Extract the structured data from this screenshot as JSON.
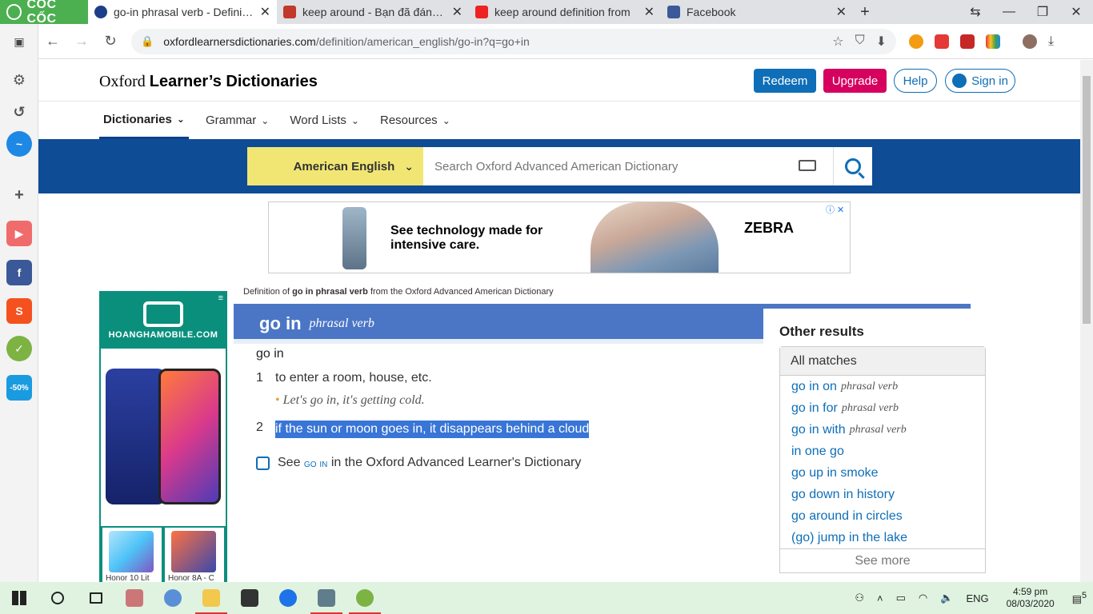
{
  "browser": {
    "brand": "CỐC CỐC",
    "tabs": [
      {
        "title": "go-in phrasal verb - Definitio",
        "active": true
      },
      {
        "title": "keep around - Bạn đã đánh v",
        "active": false
      },
      {
        "title": "keep around definition from",
        "active": false
      },
      {
        "title": "Facebook",
        "active": false
      }
    ],
    "url_host": "oxfordlearnersdictionaries.com",
    "url_path": "/definition/american_english/go-in?q=go+in"
  },
  "site": {
    "logo_light": "Oxford ",
    "logo_bold": "Learner’s Dictionaries",
    "redeem": "Redeem",
    "upgrade": "Upgrade",
    "help": "Help",
    "signin": "Sign in",
    "nav": [
      "Dictionaries",
      "Grammar",
      "Word Lists",
      "Resources"
    ],
    "dict_select": "American English",
    "search_placeholder": "Search Oxford Advanced American Dictionary"
  },
  "ad": {
    "text": "See technology made for intensive care.",
    "brand": "ZEBRA"
  },
  "side_ad": {
    "name": "HOANGHAMOBILE.COM",
    "thumbs": [
      "Honor 10 Lit",
      "Honor 8A - C"
    ]
  },
  "entry": {
    "crumb_pre": "Definition of ",
    "crumb_bold": "go in phrasal verb",
    "crumb_post": " from the Oxford Advanced American Dictionary",
    "headword": "go in",
    "pos": "phrasal verb",
    "phrase": "go in",
    "sense1_num": "1",
    "sense1": "to enter a room, house, etc.",
    "example1": "Let's go in, it's getting cold.",
    "sense2_num": "2",
    "sense2": "if the sun or moon goes in, it disappears behind a cloud",
    "see_pre": "See ",
    "see_link": "go in",
    "see_post": " in the Oxford Advanced Learner's Dictionary"
  },
  "other_results": {
    "title": "Other results",
    "header": "All matches",
    "items": [
      {
        "text": "go in on",
        "pos": "phrasal verb"
      },
      {
        "text": "go in for",
        "pos": "phrasal verb"
      },
      {
        "text": "go in with",
        "pos": "phrasal verb"
      },
      {
        "text": "in one go",
        "pos": ""
      },
      {
        "text": "go up in smoke",
        "pos": ""
      },
      {
        "text": "go down in history",
        "pos": ""
      },
      {
        "text": "go around in circles",
        "pos": ""
      },
      {
        "text": "(go) jump in the lake",
        "pos": ""
      }
    ],
    "see_more": "See more"
  },
  "taskbar": {
    "lang": "ENG",
    "time": "4:59 pm",
    "date": "08/03/2020",
    "notif": "5"
  },
  "colors": {
    "oxford_blue": "#0e4c96",
    "headword_band": "#4b76c5",
    "selection": "#3875d6",
    "dict_select": "#f1e674"
  }
}
